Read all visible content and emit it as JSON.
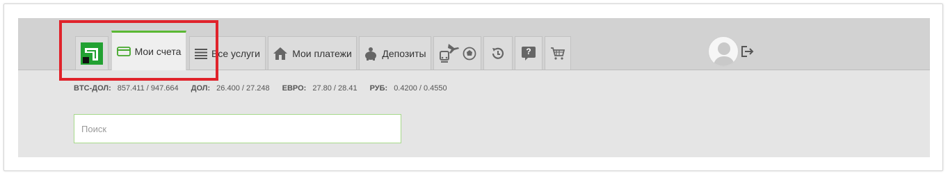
{
  "nav": {
    "tabs": {
      "accounts": "Мои счета",
      "services": "Все услуги",
      "payments": "Мои платежи",
      "deposits": "Депозиты"
    },
    "help_glyph": "?"
  },
  "rates": [
    {
      "label": "BTC-ДОЛ:",
      "value": "857.411 / 947.664"
    },
    {
      "label": "ДОЛ:",
      "value": "26.400 / 27.248"
    },
    {
      "label": "ЕВРО:",
      "value": "27.80 / 28.41"
    },
    {
      "label": "РУБ:",
      "value": "0.4200 / 0.4550"
    }
  ],
  "search": {
    "placeholder": "Поиск",
    "value": ""
  },
  "colors": {
    "accent": "#5ab833",
    "highlight": "#e0232b",
    "topbar": "#d2d2d2",
    "background": "#e5e5e5"
  },
  "icons": {
    "logo": "privatbank-logo-icon",
    "accounts": "card-icon",
    "services": "list-icon",
    "payments": "house-icon",
    "deposits": "piggy-bank-icon",
    "travel": "train-plane-icon",
    "football": "ball-icon",
    "history": "history-icon",
    "help": "help-icon",
    "cart": "cart-icon",
    "avatar": "avatar-icon",
    "logout": "logout-icon"
  }
}
